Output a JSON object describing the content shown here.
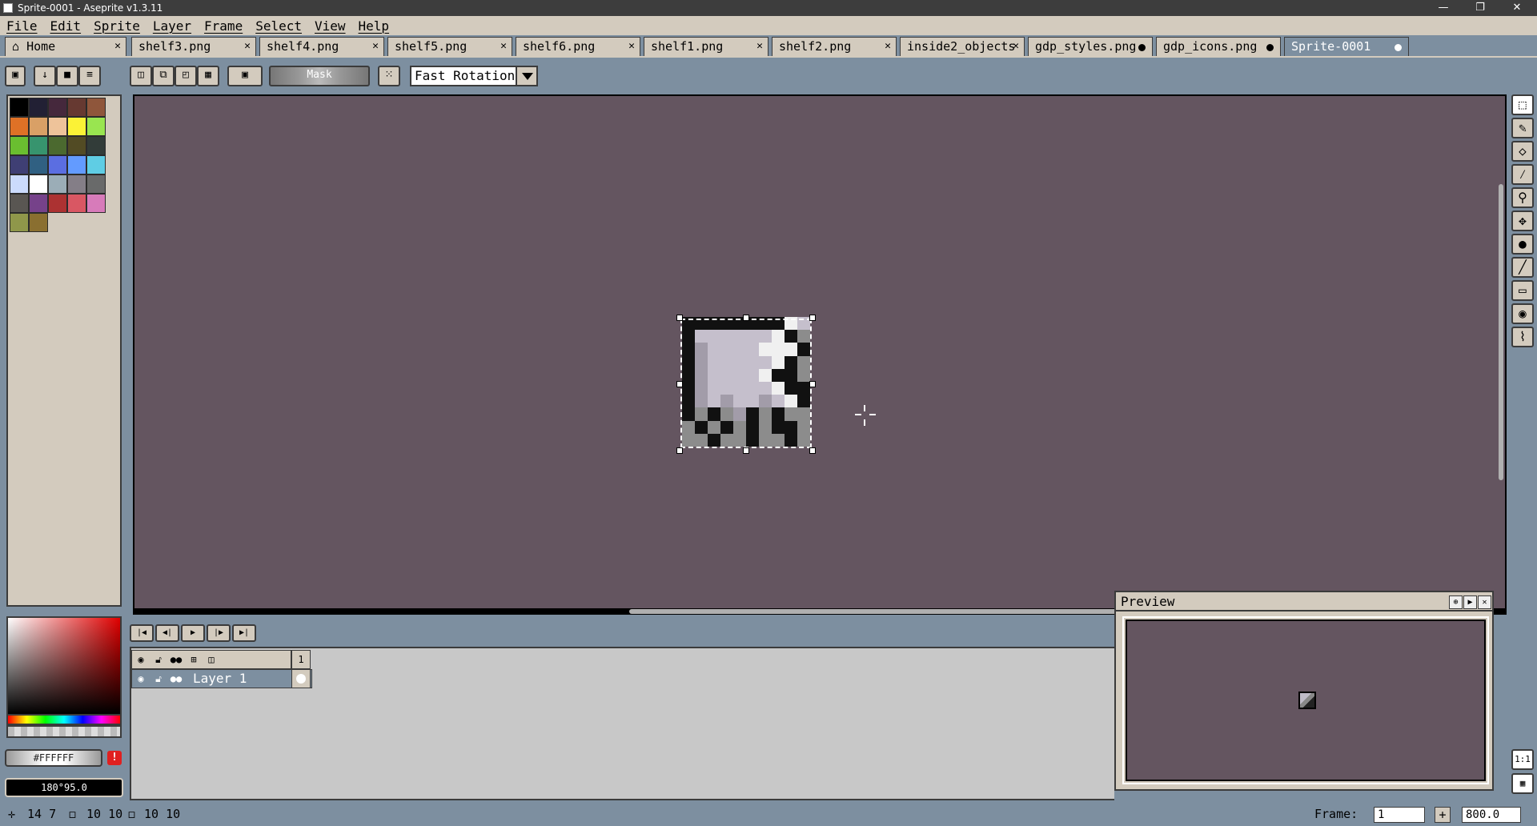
{
  "window": {
    "title": "Sprite-0001 - Aseprite v1.3.11",
    "minimize": "—",
    "restore": "❐",
    "close": "✕"
  },
  "menu": [
    "File",
    "Edit",
    "Sprite",
    "Layer",
    "Frame",
    "Select",
    "View",
    "Help"
  ],
  "tabs": [
    {
      "label": "Home",
      "icon": "home-icon",
      "state": "close"
    },
    {
      "label": "shelf3.png",
      "state": "close"
    },
    {
      "label": "shelf4.png",
      "state": "close"
    },
    {
      "label": "shelf5.png",
      "state": "close"
    },
    {
      "label": "shelf6.png",
      "state": "close"
    },
    {
      "label": "shelf1.png",
      "state": "close"
    },
    {
      "label": "shelf2.png",
      "state": "close"
    },
    {
      "label": "inside2_objects",
      "state": "close"
    },
    {
      "label": "gdp_styles.png",
      "state": "modified"
    },
    {
      "label": "gdp_icons.png",
      "state": "modified"
    },
    {
      "label": "Sprite-0001",
      "state": "modified",
      "active": true
    }
  ],
  "context_bar": {
    "mask_label": "Mask",
    "rotation_algorithm": "Fast Rotation",
    "icons": [
      "lock-icon",
      "drop-icon",
      "stop-icon",
      "menu-icon",
      "replace-selection-icon",
      "add-selection-icon",
      "subtract-selection-icon",
      "intersect-selection-icon",
      "transparent-color-icon",
      "pivot-icon"
    ]
  },
  "palette": [
    "#000000",
    "#222034",
    "#45283c",
    "#663931",
    "#8f563b",
    "#df7126",
    "#d9a066",
    "#eec39a",
    "#fbf236",
    "#99e550",
    "#6abe30",
    "#37946e",
    "#4b692f",
    "#524b24",
    "#323c39",
    "#3f3f74",
    "#306082",
    "#5b6ee1",
    "#639bff",
    "#5fcde4",
    "#cbdbfc",
    "#ffffff",
    "#9badb7",
    "#847e87",
    "#696a6a",
    "#595652",
    "#76428a",
    "#ac3232",
    "#d95763",
    "#d77bba",
    "#8f974a",
    "#8a6f30"
  ],
  "color": {
    "foreground": "#FFFFFF",
    "info": "180°95.0"
  },
  "tools": [
    "rectangular-marquee-icon",
    "pencil-icon",
    "eraser-icon",
    "eyedropper-icon",
    "zoom-icon",
    "move-icon",
    "paint-bucket-icon",
    "line-icon",
    "rectangle-icon",
    "contour-icon",
    "blur-icon"
  ],
  "timeline": {
    "controls": [
      "first-frame-icon",
      "previous-frame-icon",
      "play-icon",
      "next-frame-icon",
      "last-frame-icon"
    ],
    "frame_number": "1",
    "layer_name": "Layer 1"
  },
  "preview": {
    "title": "Preview"
  },
  "bottom_buttons": {
    "actual_size": "1:1"
  },
  "status": {
    "cursor": "14  7",
    "selection_size": "10  10",
    "sprite_size": "10  10",
    "frame_label": "Frame:",
    "frame_value": "1",
    "zoom": "800.0"
  }
}
